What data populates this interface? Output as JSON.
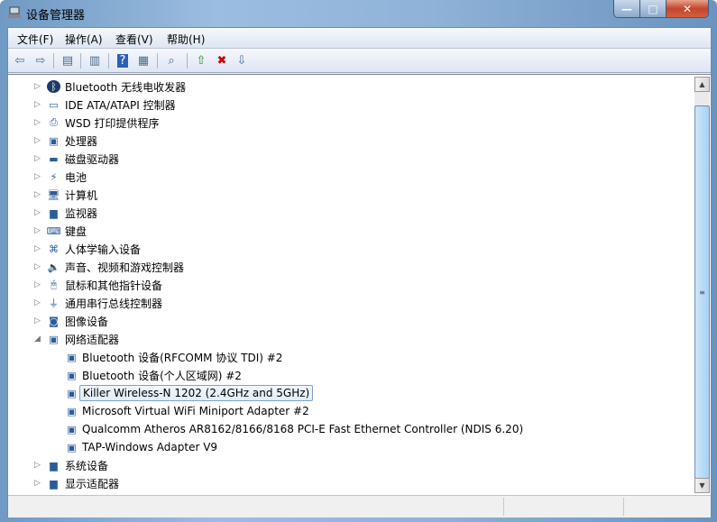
{
  "window": {
    "title": "设备管理器",
    "minimize": "—",
    "maximize": "□",
    "close": "✕"
  },
  "menu": [
    "文件(F)",
    "操作(A)",
    "查看(V)",
    "帮助(H)"
  ],
  "toolbar": [
    {
      "icon": "back-arrow-icon",
      "g": "⇦"
    },
    {
      "icon": "forward-arrow-icon",
      "g": "⇨"
    },
    {
      "icon": "show-hide-console-tree-icon",
      "g": "▤"
    },
    {
      "icon": "properties-icon",
      "g": "▥"
    },
    {
      "icon": "help-icon",
      "g": "?"
    },
    {
      "icon": "show-action-pane-icon",
      "g": "▦"
    },
    {
      "icon": "scan-hardware-icon",
      "g": "⌕"
    },
    {
      "icon": "update-driver-icon",
      "g": "⇧"
    },
    {
      "icon": "uninstall-icon",
      "g": "✖"
    },
    {
      "icon": "disable-device-icon",
      "g": "⇩"
    }
  ],
  "tree": [
    {
      "label": "Bluetooth 无线电收发器",
      "icon": "bluetooth-icon",
      "g": "ᛒ",
      "level": 0,
      "state": "collapsed"
    },
    {
      "label": "IDE ATA/ATAPI 控制器",
      "icon": "ide-controller-icon",
      "g": "▭",
      "level": 0,
      "state": "collapsed"
    },
    {
      "label": "WSD 打印提供程序",
      "icon": "printer-icon",
      "g": "⎙",
      "level": 0,
      "state": "collapsed"
    },
    {
      "label": "处理器",
      "icon": "processor-icon",
      "g": "▣",
      "level": 0,
      "state": "collapsed"
    },
    {
      "label": "磁盘驱动器",
      "icon": "disk-drive-icon",
      "g": "▬",
      "level": 0,
      "state": "collapsed"
    },
    {
      "label": "电池",
      "icon": "battery-icon",
      "g": "⚡",
      "level": 0,
      "state": "collapsed"
    },
    {
      "label": "计算机",
      "icon": "computer-icon",
      "g": "🖥",
      "level": 0,
      "state": "collapsed"
    },
    {
      "label": "监视器",
      "icon": "monitor-icon",
      "g": "▆",
      "level": 0,
      "state": "collapsed"
    },
    {
      "label": "键盘",
      "icon": "keyboard-icon",
      "g": "⌨",
      "level": 0,
      "state": "collapsed"
    },
    {
      "label": "人体学输入设备",
      "icon": "hid-icon",
      "g": "⌘",
      "level": 0,
      "state": "collapsed"
    },
    {
      "label": "声音、视频和游戏控制器",
      "icon": "speaker-icon",
      "g": "🔈",
      "level": 0,
      "state": "collapsed"
    },
    {
      "label": "鼠标和其他指针设备",
      "icon": "mouse-icon",
      "g": "🖱",
      "level": 0,
      "state": "collapsed"
    },
    {
      "label": "通用串行总线控制器",
      "icon": "usb-icon",
      "g": "⏚",
      "level": 0,
      "state": "collapsed"
    },
    {
      "label": "图像设备",
      "icon": "camera-icon",
      "g": "◙",
      "level": 0,
      "state": "collapsed"
    },
    {
      "label": "网络适配器",
      "icon": "network-adapter-icon",
      "g": "▣",
      "level": 0,
      "state": "expanded"
    },
    {
      "label": "Bluetooth 设备(RFCOMM 协议 TDI) #2",
      "icon": "network-adapter-icon",
      "g": "▣",
      "level": 1
    },
    {
      "label": "Bluetooth 设备(个人区域网) #2",
      "icon": "network-adapter-icon",
      "g": "▣",
      "level": 1
    },
    {
      "label": "Killer Wireless-N 1202 (2.4GHz and 5GHz)",
      "icon": "network-adapter-icon",
      "g": "▣",
      "level": 1,
      "selected": true
    },
    {
      "label": "Microsoft Virtual WiFi Miniport Adapter #2",
      "icon": "network-adapter-icon",
      "g": "▣",
      "level": 1
    },
    {
      "label": "Qualcomm Atheros AR8162/8166/8168 PCI-E Fast Ethernet Controller (NDIS 6.20)",
      "icon": "network-adapter-icon",
      "g": "▣",
      "level": 1
    },
    {
      "label": "TAP-Windows Adapter V9",
      "icon": "network-adapter-icon",
      "g": "▣",
      "level": 1
    },
    {
      "label": "系统设备",
      "icon": "system-device-icon",
      "g": "▆",
      "level": 0,
      "state": "collapsed"
    },
    {
      "label": "显示适配器",
      "icon": "display-adapter-icon",
      "g": "▆",
      "level": 0,
      "state": "collapsed"
    }
  ],
  "scrollbar": {
    "up": "▲",
    "down": "▼",
    "grip": "≡"
  }
}
